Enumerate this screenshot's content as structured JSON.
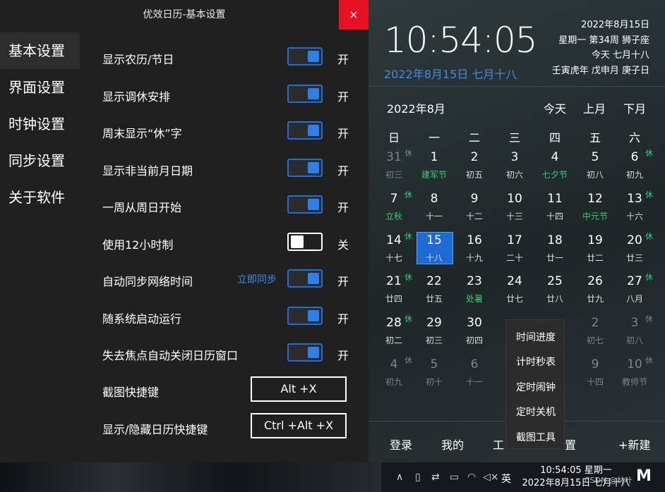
{
  "settings": {
    "title": "优效日历-基本设置",
    "close": "×",
    "nav": [
      "基本设置",
      "界面设置",
      "时钟设置",
      "同步设置",
      "关于软件"
    ],
    "rows": [
      {
        "label": "显示农历/节日",
        "state": "开",
        "on": true
      },
      {
        "label": "显示调休安排",
        "state": "开",
        "on": true
      },
      {
        "label": "周末显示“休”字",
        "state": "开",
        "on": true
      },
      {
        "label": "显示非当前月日期",
        "state": "开",
        "on": true
      },
      {
        "label": "一周从周日开始",
        "state": "开",
        "on": true
      },
      {
        "label": "使用12小时制",
        "state": "关",
        "on": false
      },
      {
        "label": "自动同步网络时间",
        "state": "开",
        "on": true
      },
      {
        "label": "随系统启动运行",
        "state": "开",
        "on": true
      },
      {
        "label": "失去焦点自动关闭日历窗口",
        "state": "开",
        "on": true
      }
    ],
    "sync_link": "立即同步",
    "shortcuts": [
      {
        "label": "截图快捷键",
        "key": "Alt +X"
      },
      {
        "label": "显示/隐藏日历快捷键",
        "key": "Ctrl +Alt +X"
      }
    ]
  },
  "calendar": {
    "time": "10:54:05",
    "date_lunar": "2022年8月15日 七月十八",
    "info": [
      "2022年8月15日",
      "星期一 第34周 狮子座",
      "今天 七月十八",
      "壬寅虎年 戊申月 庚子日"
    ],
    "month_title": "2022年8月",
    "nav": {
      "today": "今天",
      "prev": "上月",
      "next": "下月"
    },
    "weekdays": [
      "日",
      "一",
      "二",
      "三",
      "四",
      "五",
      "六"
    ],
    "weeks": [
      [
        {
          "d": "31",
          "l": "初三",
          "h": "休",
          "dim": true
        },
        {
          "d": "1",
          "l": "建军节",
          "g": true
        },
        {
          "d": "2",
          "l": "初五"
        },
        {
          "d": "3",
          "l": "初六"
        },
        {
          "d": "4",
          "l": "七夕节",
          "g": true
        },
        {
          "d": "5",
          "l": "初八"
        },
        {
          "d": "6",
          "l": "初九",
          "h": "休"
        }
      ],
      [
        {
          "d": "7",
          "l": "立秋",
          "h": "休",
          "g": true
        },
        {
          "d": "8",
          "l": "十一"
        },
        {
          "d": "9",
          "l": "十二"
        },
        {
          "d": "10",
          "l": "十三"
        },
        {
          "d": "11",
          "l": "十四"
        },
        {
          "d": "12",
          "l": "中元节",
          "g": true
        },
        {
          "d": "13",
          "l": "十六",
          "h": "休"
        }
      ],
      [
        {
          "d": "14",
          "l": "十七",
          "h": "休"
        },
        {
          "d": "15",
          "l": "十八",
          "today": true
        },
        {
          "d": "16",
          "l": "十九"
        },
        {
          "d": "17",
          "l": "二十"
        },
        {
          "d": "18",
          "l": "廿一"
        },
        {
          "d": "19",
          "l": "廿二"
        },
        {
          "d": "20",
          "l": "廿三",
          "h": "休"
        }
      ],
      [
        {
          "d": "21",
          "l": "廿四",
          "h": "休"
        },
        {
          "d": "22",
          "l": "廿五"
        },
        {
          "d": "23",
          "l": "处暑",
          "g": true
        },
        {
          "d": "24",
          "l": "廿七"
        },
        {
          "d": "25",
          "l": "廿八"
        },
        {
          "d": "26",
          "l": "廿九"
        },
        {
          "d": "27",
          "l": "八月",
          "h": "休"
        }
      ],
      [
        {
          "d": "28",
          "l": "初二",
          "h": "休"
        },
        {
          "d": "29",
          "l": "初三"
        },
        {
          "d": "30",
          "l": "初四"
        },
        {
          "d": "",
          "l": ""
        },
        {
          "d": "",
          "l": ""
        },
        {
          "d": "2",
          "l": "初七",
          "dim": true
        },
        {
          "d": "3",
          "l": "初八",
          "h": "休",
          "dim": true
        }
      ],
      [
        {
          "d": "4",
          "l": "初九",
          "h": "休",
          "dim": true
        },
        {
          "d": "5",
          "l": "初十",
          "dim": true
        },
        {
          "d": "6",
          "l": "十一",
          "dim": true
        },
        {
          "d": "",
          "l": ""
        },
        {
          "d": "",
          "l": ""
        },
        {
          "d": "9",
          "l": "十四",
          "dim": true
        },
        {
          "d": "10",
          "l": "教师节",
          "h": "休",
          "dim": true
        }
      ]
    ],
    "bottom": [
      "登录",
      "我的",
      "工",
      "置",
      "+新建"
    ],
    "menu": [
      "时间进度",
      "计时秒表",
      "定时闹钟",
      "定时关机",
      "截图工具"
    ]
  },
  "taskbar": {
    "icons": [
      "∧",
      "▯",
      "⇄",
      "▭",
      "◠",
      "◁×"
    ],
    "ime": "英",
    "clock_time": "10:54:05 星期一",
    "clock_date": "2022年8月15日 七月十八",
    "watermark": "CSDN @林叶",
    "logo": "M"
  }
}
